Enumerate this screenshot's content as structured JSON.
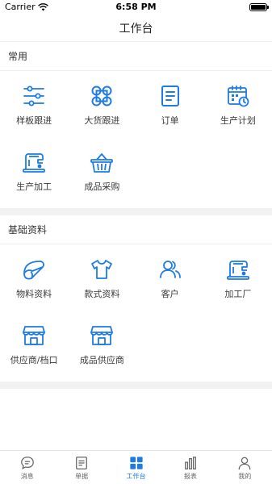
{
  "status_bar": {
    "carrier": "Carrier",
    "time": "6:58 PM"
  },
  "nav": {
    "title": "工作台"
  },
  "sections": [
    {
      "title": "常用",
      "items": [
        {
          "label": "样板跟进",
          "icon": "sliders-icon"
        },
        {
          "label": "大货跟进",
          "icon": "four-circles-icon"
        },
        {
          "label": "订单",
          "icon": "order-document-icon"
        },
        {
          "label": "生产计划",
          "icon": "calendar-clock-icon"
        },
        {
          "label": "生产加工",
          "icon": "sewing-machine-icon"
        },
        {
          "label": "成品采购",
          "icon": "basket-icon"
        }
      ]
    },
    {
      "title": "基础资料",
      "items": [
        {
          "label": "物料资料",
          "icon": "fabric-roll-icon"
        },
        {
          "label": "款式资料",
          "icon": "tshirt-icon"
        },
        {
          "label": "客户",
          "icon": "users-icon"
        },
        {
          "label": "加工厂",
          "icon": "sewing-machine-icon"
        },
        {
          "label": "供应商/档口",
          "icon": "storefront-icon"
        },
        {
          "label": "成品供应商",
          "icon": "storefront-icon"
        }
      ]
    }
  ],
  "tabs": [
    {
      "label": "消息",
      "icon": "chat-bubble-icon",
      "active": false
    },
    {
      "label": "单据",
      "icon": "document-list-icon",
      "active": false
    },
    {
      "label": "工作台",
      "icon": "grid-icon",
      "active": true
    },
    {
      "label": "报表",
      "icon": "bar-chart-icon",
      "active": false
    },
    {
      "label": "我的",
      "icon": "person-icon",
      "active": false
    }
  ],
  "colors": {
    "accent": "#1e7be4",
    "separator": "#f2f2f2"
  }
}
